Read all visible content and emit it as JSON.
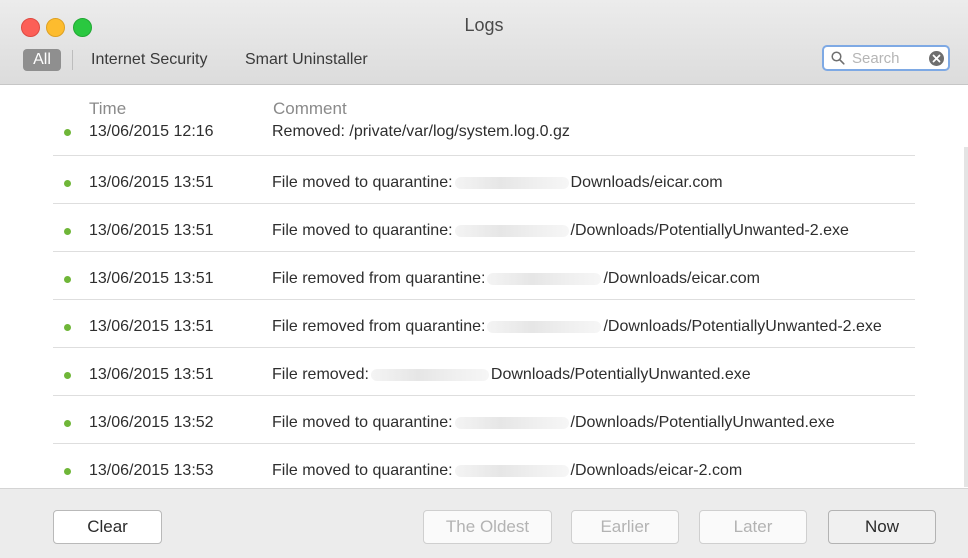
{
  "window": {
    "title": "Logs"
  },
  "filters": {
    "all": "All",
    "internet_security": "Internet Security",
    "smart_uninstaller": "Smart Uninstaller"
  },
  "search": {
    "placeholder": "Search",
    "value": ""
  },
  "table": {
    "headers": {
      "time": "Time",
      "comment": "Comment"
    },
    "rows": [
      {
        "time": "13/06/2015 12:16",
        "prefix": "Removed: /private/var/log/system.log.0.gz",
        "suffix": "",
        "status_color": "#6fb638"
      },
      {
        "time": "13/06/2015 13:51",
        "prefix": "File moved to quarantine:",
        "suffix": "Downloads/eicar.com",
        "status_color": "#6fb638"
      },
      {
        "time": "13/06/2015 13:51",
        "prefix": "File moved to quarantine:",
        "suffix": "/Downloads/PotentiallyUnwanted-2.exe",
        "status_color": "#6fb638"
      },
      {
        "time": "13/06/2015 13:51",
        "prefix": "File removed from quarantine:",
        "suffix": "/Downloads/eicar.com",
        "status_color": "#6fb638"
      },
      {
        "time": "13/06/2015 13:51",
        "prefix": "File removed from quarantine:",
        "suffix": "/Downloads/PotentiallyUnwanted-2.exe",
        "status_color": "#6fb638"
      },
      {
        "time": "13/06/2015 13:51",
        "prefix": "File removed:",
        "suffix": "Downloads/PotentiallyUnwanted.exe",
        "status_color": "#6fb638"
      },
      {
        "time": "13/06/2015 13:52",
        "prefix": "File moved to quarantine:",
        "suffix": "/Downloads/PotentiallyUnwanted.exe",
        "status_color": "#6fb638"
      },
      {
        "time": "13/06/2015 13:53",
        "prefix": "File moved to quarantine:",
        "suffix": "/Downloads/eicar-2.com",
        "status_color": "#6fb638"
      }
    ]
  },
  "buttons": {
    "clear": "Clear",
    "oldest": "The Oldest",
    "earlier": "Earlier",
    "later": "Later",
    "now": "Now"
  }
}
